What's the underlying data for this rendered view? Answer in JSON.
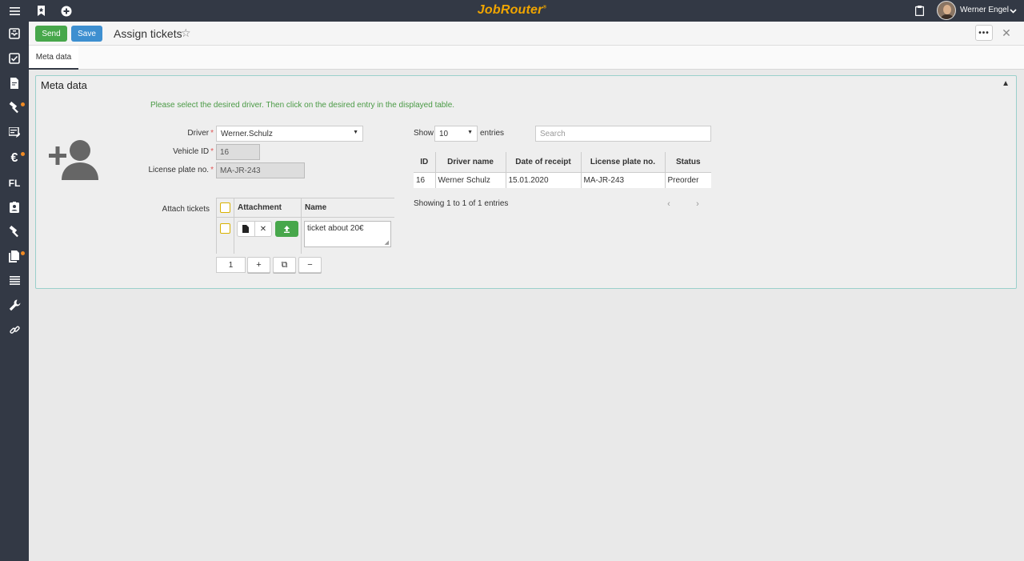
{
  "topbar": {
    "logo_text": "JobRouter",
    "logo_mark": "®",
    "user_name": "Werner Engel",
    "icons": [
      "menu-icon",
      "bookmark-icon",
      "plus-circle-icon",
      "clipboard-icon",
      "chevron-down-icon"
    ]
  },
  "sidebar": {
    "items": [
      {
        "icon": "inbox-icon"
      },
      {
        "icon": "task-check-icon"
      },
      {
        "icon": "document-icon"
      },
      {
        "icon": "hammer-icon",
        "badge": true
      },
      {
        "icon": "form-icon"
      },
      {
        "icon": "euro-icon",
        "badge": true,
        "text": "€"
      },
      {
        "icon": "fl-icon",
        "text": "FL"
      },
      {
        "icon": "contact-card-icon"
      },
      {
        "icon": "hammer-icon"
      },
      {
        "icon": "documents-icon",
        "badge": true
      },
      {
        "icon": "list-icon"
      },
      {
        "icon": "wrench-icon"
      },
      {
        "icon": "link-icon"
      }
    ]
  },
  "actionbar": {
    "send_label": "Send",
    "save_label": "Save",
    "title": "Assign tickets",
    "more_label": "•••"
  },
  "tabs": [
    {
      "label": "Meta data"
    }
  ],
  "panel": {
    "title": "Meta data",
    "hint": "Please select the desired driver. Then click on the desired entry in the displayed table.",
    "form": {
      "driver_label": "Driver",
      "driver_value": "Werner.Schulz",
      "vehicle_label": "Vehicle ID",
      "vehicle_value": "16",
      "plate_label": "License plate no.",
      "plate_value": "MA-JR-243",
      "required_mark": "*"
    },
    "attachments": {
      "label": "Attach tickets",
      "header_attachment": "Attachment",
      "header_name": "Name",
      "row_name": "ticket about 20€",
      "row_count": "1",
      "add_label": "+",
      "copy_label": "⧉",
      "remove_label": "−"
    },
    "table": {
      "show_label": "Show",
      "show_value": "10",
      "entries_label": "entries",
      "search_placeholder": "Search",
      "columns": [
        "ID",
        "Driver name",
        "Date of receipt",
        "License plate no.",
        "Status"
      ],
      "rows": [
        [
          "16",
          "Werner Schulz",
          "15.01.2020",
          "MA-JR-243",
          "Preorder"
        ]
      ],
      "info": "Showing 1 to 1 of 1 entries",
      "prev_label": "‹",
      "next_label": "›"
    }
  },
  "colors": {
    "sidebar": "#333945",
    "send": "#47a74b",
    "save": "#3d8fd0",
    "hint": "#4a9a45",
    "accent_logo": "#f0a500",
    "badge": "#f08a24",
    "panel_border": "#9ad0cb"
  }
}
